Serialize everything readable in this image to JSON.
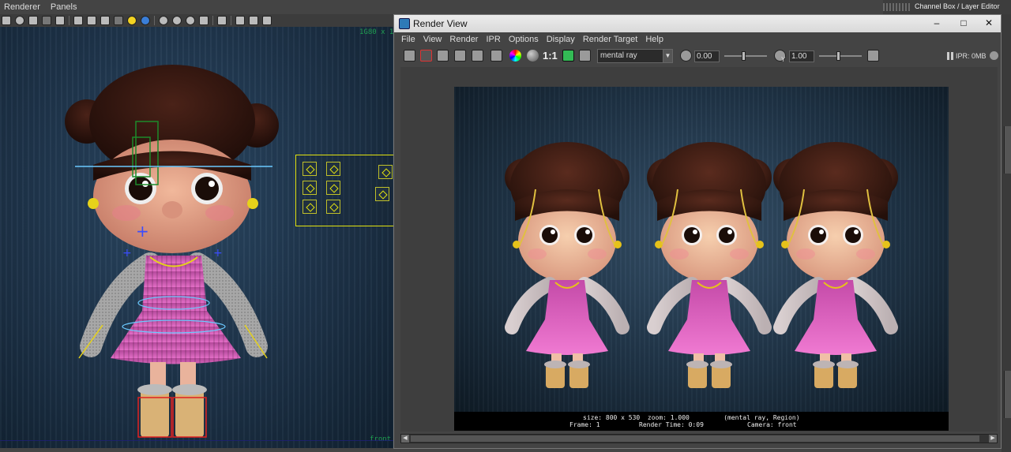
{
  "maya": {
    "menus": [
      "Renderer",
      "Panels"
    ],
    "channel_box_title": "Channel Box / Layer Editor"
  },
  "viewport": {
    "top_label": "1G80 x 1",
    "camera_label": "front"
  },
  "render_view": {
    "title": "Render View",
    "menus": [
      "File",
      "View",
      "Render",
      "IPR",
      "Options",
      "Display",
      "Render Target",
      "Help"
    ],
    "toolbar": {
      "ratio_label": "1:1",
      "renderer": "mental ray",
      "exposure_value": "0.00",
      "gamma_value": "1.00",
      "gamma_symbol": "Y",
      "ipr_memory": "IPR: 0MB"
    },
    "status": {
      "line1": "size: 800 x 530  zoom: 1.000         (mental ray, Region)",
      "line2_frame": "Frame: 1",
      "line2_time": "Render Time: 0:09",
      "line2_camera": "Camera: front"
    }
  },
  "colors": {
    "viewport_bg": "#1d3248",
    "control_yellow": "#e3e30f",
    "dress_pink": "#d858b8",
    "hair_brown": "#3a1a12"
  }
}
